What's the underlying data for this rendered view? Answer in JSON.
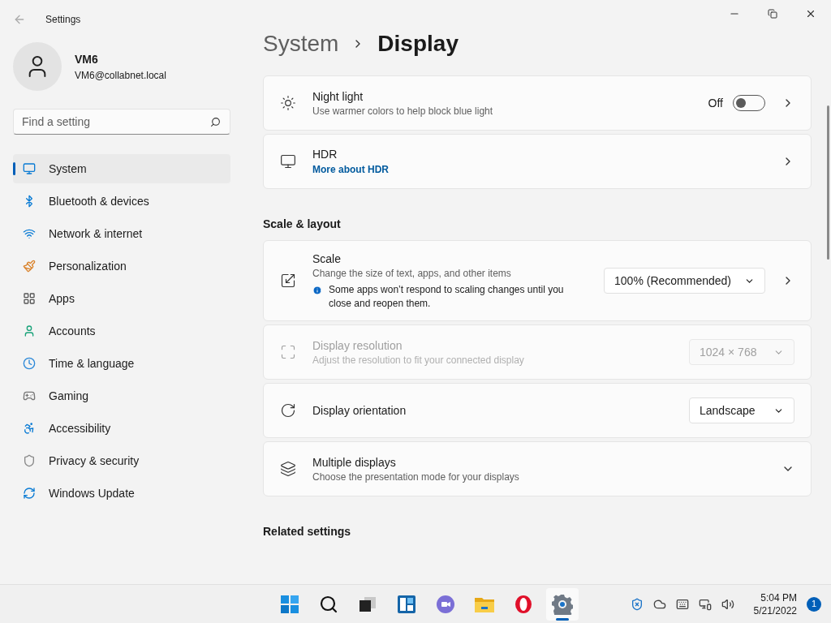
{
  "window": {
    "title": "Settings"
  },
  "user": {
    "name": "VM6",
    "email": "VM6@collabnet.local"
  },
  "search": {
    "placeholder": "Find a setting"
  },
  "nav": [
    {
      "label": "System",
      "selected": true
    },
    {
      "label": "Bluetooth & devices",
      "selected": false
    },
    {
      "label": "Network & internet",
      "selected": false
    },
    {
      "label": "Personalization",
      "selected": false
    },
    {
      "label": "Apps",
      "selected": false
    },
    {
      "label": "Accounts",
      "selected": false
    },
    {
      "label": "Time & language",
      "selected": false
    },
    {
      "label": "Gaming",
      "selected": false
    },
    {
      "label": "Accessibility",
      "selected": false
    },
    {
      "label": "Privacy & security",
      "selected": false
    },
    {
      "label": "Windows Update",
      "selected": false
    }
  ],
  "breadcrumb": [
    "System",
    "Display"
  ],
  "groups": [
    {
      "cards": [
        {
          "kind": "toggle",
          "title": "Night light",
          "subtitle": "Use warmer colors to help block blue light",
          "state_label": "Off",
          "on": false
        },
        {
          "kind": "link",
          "title": "HDR",
          "link": "More about HDR"
        }
      ]
    },
    {
      "heading": "Scale & layout",
      "cards": [
        {
          "kind": "dropdown",
          "title": "Scale",
          "subtitle": "Change the size of text, apps, and other items",
          "note": "Some apps won’t respond to scaling changes until you close and reopen them.",
          "value": "100% (Recommended)",
          "disabled": false,
          "chevron": true
        },
        {
          "kind": "dropdown",
          "title": "Display resolution",
          "subtitle": "Adjust the resolution to fit your connected display",
          "value": "1024 × 768",
          "disabled": true,
          "chevron": false
        },
        {
          "kind": "dropdown",
          "title": "Display orientation",
          "value": "Landscape",
          "disabled": false,
          "chevron": false
        },
        {
          "kind": "expand",
          "title": "Multiple displays",
          "subtitle": "Choose the presentation mode for your displays",
          "expanded": false
        }
      ]
    },
    {
      "heading": "Related settings"
    }
  ],
  "taskbar": {
    "apps": [
      {
        "selected": false
      },
      {
        "selected": false
      },
      {
        "selected": false
      },
      {
        "selected": false
      },
      {
        "selected": false
      },
      {
        "selected": false
      },
      {
        "selected": false
      },
      {
        "selected": true
      }
    ],
    "time": "5:04 PM",
    "date": "5/21/2022",
    "badge": "1"
  }
}
